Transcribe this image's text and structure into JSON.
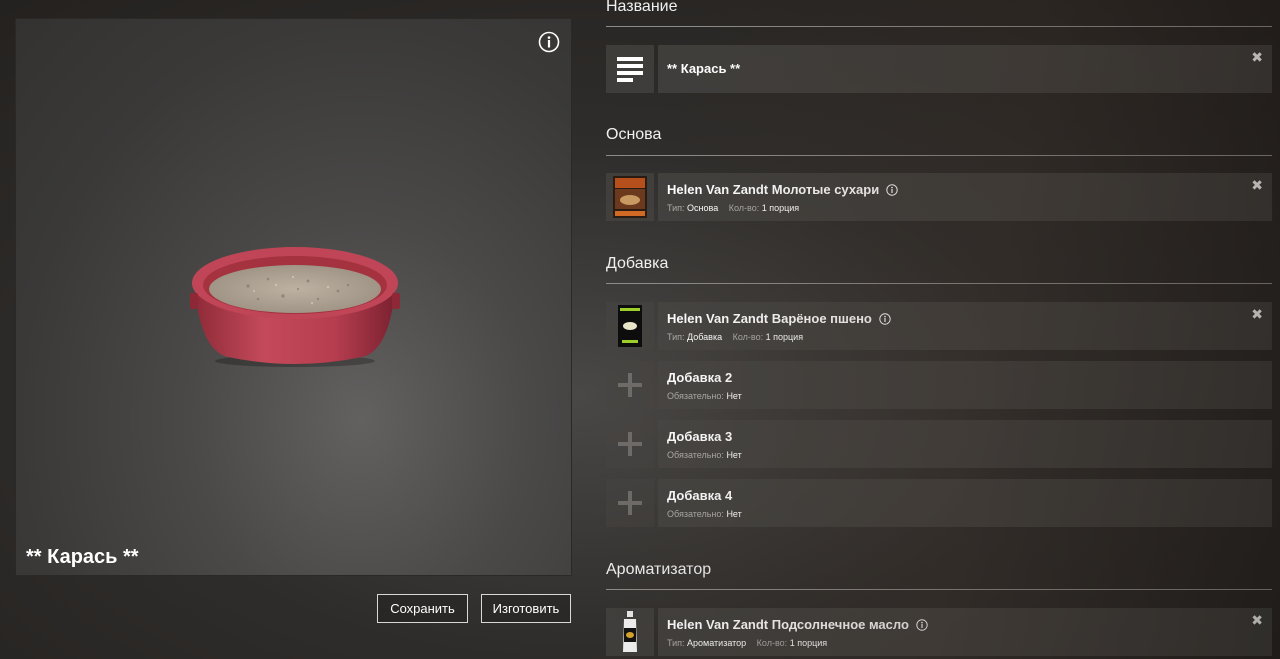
{
  "preview": {
    "recipe_name": "** Карась **",
    "info_icon": "info-circle-icon",
    "image": "groundbait-bowl"
  },
  "buttons": {
    "save_label": "Сохранить",
    "make_label": "Изготовить"
  },
  "sections": {
    "name": {
      "title": "Название",
      "value": "** Карась **",
      "icon": "text-lines-icon"
    },
    "base": {
      "title": "Основа",
      "item": {
        "name": "Helen Van Zandt Молотые сухари",
        "type_label": "Тип:",
        "type_value": "Основа",
        "qty_label": "Кол-во:",
        "qty_value": "1 порция"
      }
    },
    "additive": {
      "title": "Добавка",
      "item": {
        "name": "Helen Van Zandt Варёное пшено",
        "type_label": "Тип:",
        "type_value": "Добавка",
        "qty_label": "Кол-во:",
        "qty_value": "1 порция"
      },
      "empty_slots": [
        {
          "name": "Добавка 2",
          "req_label": "Обязательно:",
          "req_value": "Нет"
        },
        {
          "name": "Добавка 3",
          "req_label": "Обязательно:",
          "req_value": "Нет"
        },
        {
          "name": "Добавка 4",
          "req_label": "Обязательно:",
          "req_value": "Нет"
        }
      ]
    },
    "flavor": {
      "title": "Ароматизатор",
      "item": {
        "name": "Helen Van Zandt Подсолнечное масло",
        "type_label": "Тип:",
        "type_value": "Ароматизатор",
        "qty_label": "Кол-во:",
        "qty_value": "1 порция"
      }
    }
  },
  "close_symbol": "✖"
}
